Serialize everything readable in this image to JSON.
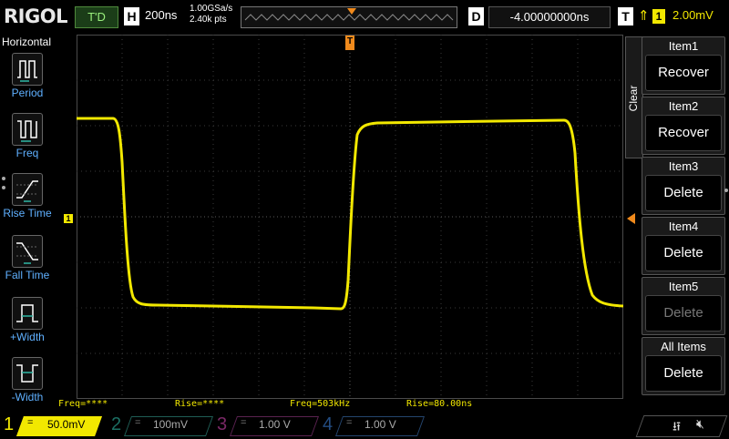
{
  "header": {
    "logo": "RIGOL",
    "trigger_status": "T'D",
    "horizontal_label": "H",
    "timebase": "200ns",
    "sample_rate": "1.00GSa/s",
    "memory_depth": "2.40k pts",
    "delay_label": "D",
    "delay_value": "-4.00000000ns",
    "trigger_label": "T",
    "trigger_edge_icon": "rising-edge-icon",
    "trigger_source": "1",
    "trigger_level": "2.00mV"
  },
  "left_panel": {
    "title": "Horizontal",
    "items": [
      {
        "label": "Period",
        "icon": "period-icon"
      },
      {
        "label": "Freq",
        "icon": "frequency-icon"
      },
      {
        "label": "Rise Time",
        "icon": "rise-time-icon"
      },
      {
        "label": "Fall Time",
        "icon": "fall-time-icon"
      },
      {
        "label": "+Width",
        "icon": "positive-width-icon"
      },
      {
        "label": "-Width",
        "icon": "negative-width-icon"
      }
    ]
  },
  "markers": {
    "ch1_level": "1",
    "trigger_position": "T"
  },
  "measurements": [
    {
      "text": "Freq=****"
    },
    {
      "text": "Rise=****"
    },
    {
      "text": "Freq=503kHz"
    },
    {
      "text": "Rise=80.00ns"
    }
  ],
  "right_menu": {
    "clear_label": "Clear",
    "items": [
      {
        "title": "Item1",
        "button": "Recover",
        "enabled": true
      },
      {
        "title": "Item2",
        "button": "Recover",
        "enabled": true
      },
      {
        "title": "Item3",
        "button": "Delete",
        "enabled": true
      },
      {
        "title": "Item4",
        "button": "Delete",
        "enabled": true
      },
      {
        "title": "Item5",
        "button": "Delete",
        "enabled": false
      },
      {
        "title": "All Items",
        "button": "Delete",
        "enabled": true
      }
    ]
  },
  "channels": [
    {
      "num": "1",
      "coupling": "=",
      "scale": "50.0mV",
      "color": "#f2e800",
      "active": true
    },
    {
      "num": "2",
      "coupling": "=",
      "scale": "100mV",
      "color": "#2fb9a6",
      "active": false
    },
    {
      "num": "3",
      "coupling": "=",
      "scale": "1.00 V",
      "color": "#cc44aa",
      "active": false
    },
    {
      "num": "4",
      "coupling": "=",
      "scale": "1.00 V",
      "color": "#3b7fd8",
      "active": false
    }
  ],
  "status_icons": {
    "usb": "usb-icon",
    "sound": "speaker-muted-icon"
  },
  "colors": {
    "trace": "#f2e800",
    "grid": "#3a3a3a",
    "trigger": "#f08a1c",
    "menu_label": "#5fb0ff"
  }
}
